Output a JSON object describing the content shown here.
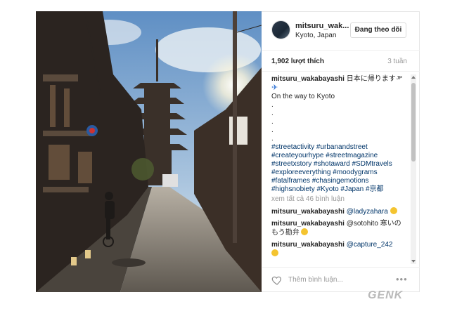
{
  "post": {
    "username": "mitsuru_wak...",
    "location": "Kyoto, Japan",
    "follow_button": "Đang theo dõi",
    "likes": "1,902 lượt thích",
    "time": "3 tuần"
  },
  "caption": {
    "username": "mitsuru_wakabayashi",
    "title": "日本に帰ります",
    "flag_text": "JP",
    "line2": "On the way to Kyoto",
    "dots": [
      ".",
      ".",
      ".",
      ".",
      "."
    ],
    "hashtags": [
      "#streetactivity #urbanandstreet",
      "#createyourhype #streetmagazine",
      "#streetxstory #shotaward #SDMtravels",
      "#exploreeverything #moodygrams",
      "#fatalframes #chasingemotions",
      "#highsnobiety #Kyoto #Japan #京都"
    ]
  },
  "view_all": "xem tất cả 46 bình luận",
  "comments": [
    {
      "user": "mitsuru_wakabayashi",
      "text": "@ladyzahara"
    },
    {
      "user": "mitsuru_wakabayashi",
      "text": "@sotohito 寒いの",
      "text2": "もう勘弁"
    },
    {
      "user": "mitsuru_wakabayashi",
      "text": "@capture_242"
    }
  ],
  "footer": {
    "placeholder": "Thêm bình luận...",
    "more": "•••"
  },
  "watermark": "GENK"
}
